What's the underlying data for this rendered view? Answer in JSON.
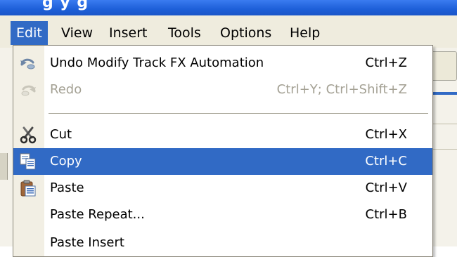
{
  "window": {
    "title_fragment": "g   y   g"
  },
  "menubar": {
    "items": [
      {
        "label": "Edit",
        "active": true
      },
      {
        "label": "View"
      },
      {
        "label": "Insert"
      },
      {
        "label": "Tools"
      },
      {
        "label": "Options"
      },
      {
        "label": "Help"
      }
    ]
  },
  "edit_menu": {
    "items": [
      {
        "label": "Undo Modify Track FX Automation",
        "mnemonic": "U",
        "shortcut": "Ctrl+Z",
        "icon": "undo-icon"
      },
      {
        "label": "Redo",
        "mnemonic": "R",
        "shortcut": "Ctrl+Y; Ctrl+Shift+Z",
        "icon": "redo-icon",
        "disabled": true
      },
      {
        "label": "Cut",
        "mnemonic": "t",
        "shortcut": "Ctrl+X",
        "icon": "scissors-icon"
      },
      {
        "label": "Copy",
        "mnemonic": "C",
        "shortcut": "Ctrl+C",
        "icon": "copy-icon",
        "highlighted": true
      },
      {
        "label": "Paste",
        "mnemonic": "P",
        "shortcut": "Ctrl+V",
        "icon": "clipboard-icon"
      },
      {
        "label": "Paste Repeat...",
        "mnemonic": "a",
        "shortcut": "Ctrl+B"
      },
      {
        "label": "Paste Insert",
        "mnemonic": ""
      }
    ]
  },
  "colors": {
    "highlight": "#316ac5",
    "menubar_bg": "#efecde",
    "gutter_bg": "#f2efe4",
    "disabled_text": "#a4a194"
  }
}
